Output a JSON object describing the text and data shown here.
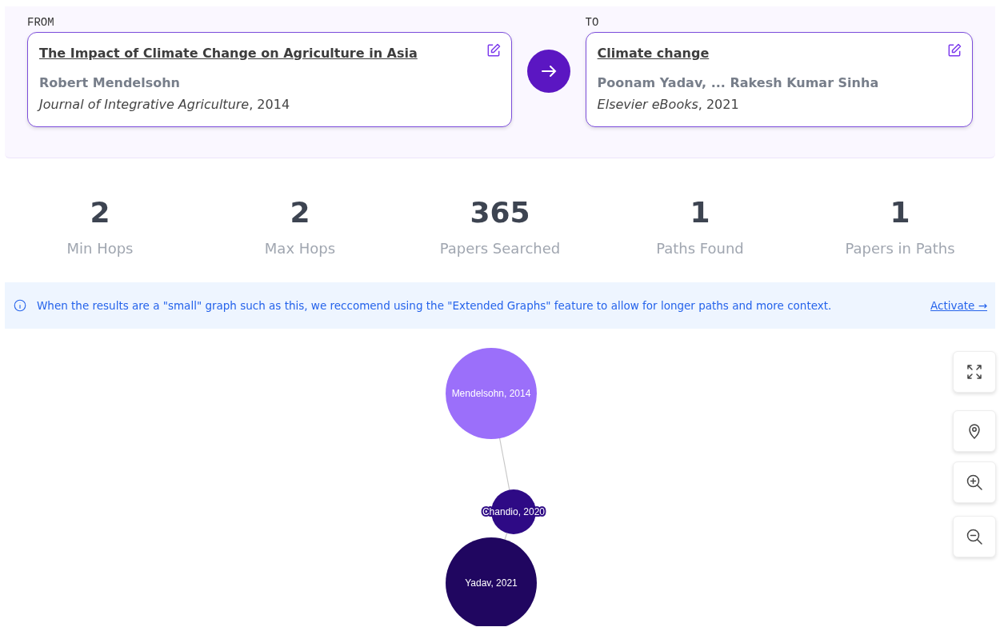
{
  "route": {
    "from": {
      "label": "FROM",
      "title": "The Impact of Climate Change on Agriculture in Asia",
      "authors": "Robert Mendelsohn",
      "venue": "Journal of Integrative Agriculture",
      "year": ", 2014"
    },
    "to": {
      "label": "TO",
      "title": "Climate change",
      "authors": "Poonam Yadav, ... Rakesh Kumar Sinha",
      "venue": "Elsevier eBooks",
      "year": ", 2021"
    }
  },
  "stats": [
    {
      "value": "2",
      "label": "Min Hops"
    },
    {
      "value": "2",
      "label": "Max Hops"
    },
    {
      "value": "365",
      "label": "Papers Searched"
    },
    {
      "value": "1",
      "label": "Paths Found"
    },
    {
      "value": "1",
      "label": "Papers in Paths"
    }
  ],
  "notice": {
    "text": "When the results are a \"small\" graph such as this, we reccomend using the \"Extended Graphs\" feature to allow for longer paths and more context.",
    "link": "Activate →"
  },
  "graph": {
    "nodes": [
      {
        "label": "Mendelsohn, 2014",
        "color": "#9b6ffa"
      },
      {
        "label": "Chandio, 2020",
        "color": "#2e0a85"
      },
      {
        "label": "Yadav, 2021",
        "color": "#200660"
      }
    ]
  }
}
